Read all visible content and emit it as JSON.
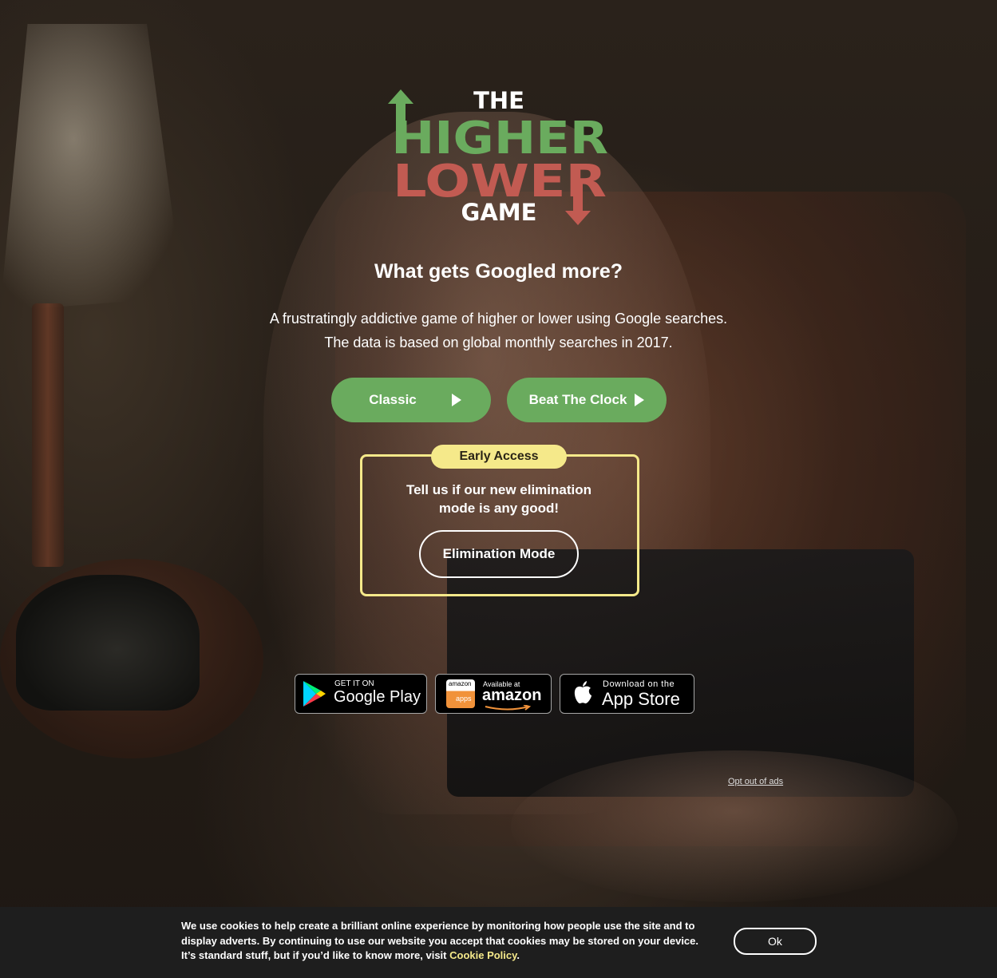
{
  "logo": {
    "the": "THE",
    "higher": "HIGHER",
    "lower": "LOWER",
    "game": "GAME",
    "higher_color": "#6aab5e",
    "lower_color": "#c25b52"
  },
  "hero": {
    "tagline": "What gets Googled more?",
    "desc_line1": "A frustratingly addictive game of higher or lower using Google searches.",
    "desc_line2": "The data is based on global monthly searches in 2017."
  },
  "modes": {
    "classic_label": "Classic",
    "clock_label": "Beat The Clock",
    "button_color": "#6aab5e",
    "play_icon": "play-icon"
  },
  "early_access": {
    "badge": "Early Access",
    "text_line1": "Tell us if our new elimination",
    "text_line2": "mode is any good!",
    "button_label": "Elimination Mode",
    "accent_color": "#f5e98a"
  },
  "stores": {
    "google_small": "GET IT ON",
    "google_big": "Google Play",
    "amazon_logo_text": "amazon",
    "amazon_apps": "apps",
    "amazon_small": "Available at",
    "amazon_big": "amazon",
    "apple_small": "Download on the",
    "apple_big": "App Store"
  },
  "opt_out": "Opt out of ads",
  "cookie": {
    "text": "We use cookies to help create a brilliant online experience by monitoring how people use the site and to display adverts. By continuing to use our website you accept that cookies may be stored on your device. It’s standard stuff,  but if you’d like to know more, visit ",
    "link": "Cookie Policy",
    "suffix": ".",
    "ok": "Ok"
  }
}
